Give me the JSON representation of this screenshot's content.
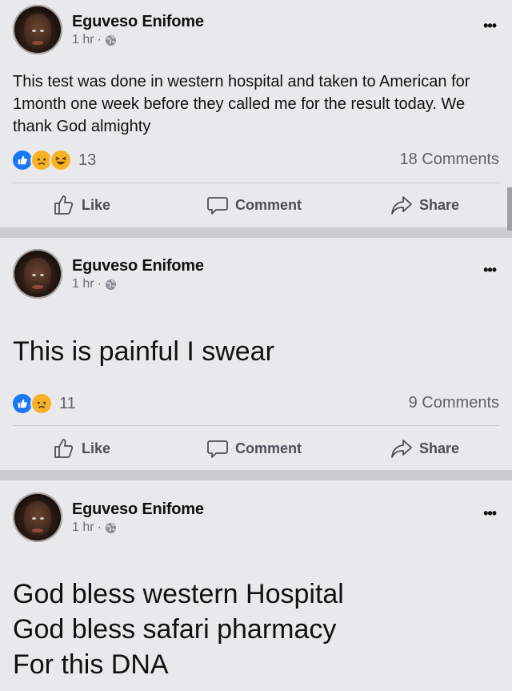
{
  "posts": [
    {
      "author": "Eguveso Enifome",
      "time": "1 hr",
      "separator": "·",
      "text": "This test was done in western hospital and taken to American for 1month one week before they called me for the result today. We thank God almighty",
      "reactions": [
        "like",
        "sad",
        "haha"
      ],
      "reaction_count": "13",
      "comments": "18 Comments"
    },
    {
      "author": "Eguveso Enifome",
      "time": "1 hr",
      "separator": "·",
      "text": "This is painful I swear",
      "reactions": [
        "like",
        "sad"
      ],
      "reaction_count": "11",
      "comments": "9 Comments"
    },
    {
      "author": "Eguveso Enifome",
      "time": "1 hr",
      "separator": "·",
      "text_lines": [
        "God bless western Hospital",
        "God bless safari pharmacy",
        "For this DNA"
      ]
    }
  ],
  "actions": {
    "like": "Like",
    "comment": "Comment",
    "share": "Share"
  },
  "more_icon": "•••",
  "colors": {
    "like_blue": "#1877f2",
    "emoji_yellow": "#f7b125",
    "card_bg": "#e9e9eb",
    "separator_bg": "#cccdcf"
  }
}
